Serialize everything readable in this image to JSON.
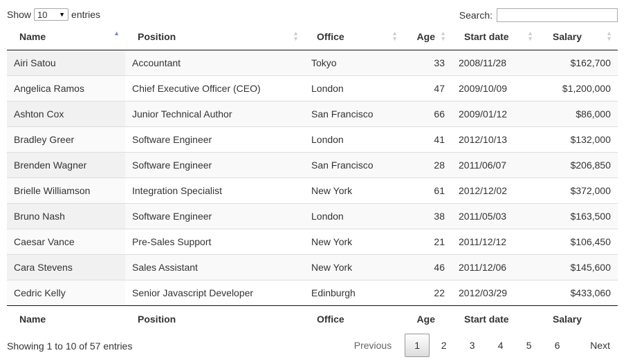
{
  "length_menu": {
    "prefix": "Show",
    "value": "10",
    "suffix": "entries"
  },
  "search": {
    "label": "Search:",
    "value": ""
  },
  "columns": [
    "Name",
    "Position",
    "Office",
    "Age",
    "Start date",
    "Salary"
  ],
  "rows": [
    [
      "Airi Satou",
      "Accountant",
      "Tokyo",
      "33",
      "2008/11/28",
      "$162,700"
    ],
    [
      "Angelica Ramos",
      "Chief Executive Officer (CEO)",
      "London",
      "47",
      "2009/10/09",
      "$1,200,000"
    ],
    [
      "Ashton Cox",
      "Junior Technical Author",
      "San Francisco",
      "66",
      "2009/01/12",
      "$86,000"
    ],
    [
      "Bradley Greer",
      "Software Engineer",
      "London",
      "41",
      "2012/10/13",
      "$132,000"
    ],
    [
      "Brenden Wagner",
      "Software Engineer",
      "San Francisco",
      "28",
      "2011/06/07",
      "$206,850"
    ],
    [
      "Brielle Williamson",
      "Integration Specialist",
      "New York",
      "61",
      "2012/12/02",
      "$372,000"
    ],
    [
      "Bruno Nash",
      "Software Engineer",
      "London",
      "38",
      "2011/05/03",
      "$163,500"
    ],
    [
      "Caesar Vance",
      "Pre-Sales Support",
      "New York",
      "21",
      "2011/12/12",
      "$106,450"
    ],
    [
      "Cara Stevens",
      "Sales Assistant",
      "New York",
      "46",
      "2011/12/06",
      "$145,600"
    ],
    [
      "Cedric Kelly",
      "Senior Javascript Developer",
      "Edinburgh",
      "22",
      "2012/03/29",
      "$433,060"
    ]
  ],
  "info": "Showing 1 to 10 of 57 entries",
  "pagination": {
    "previous": "Previous",
    "next": "Next",
    "pages": [
      "1",
      "2",
      "3",
      "4",
      "5",
      "6"
    ],
    "current": "1"
  }
}
